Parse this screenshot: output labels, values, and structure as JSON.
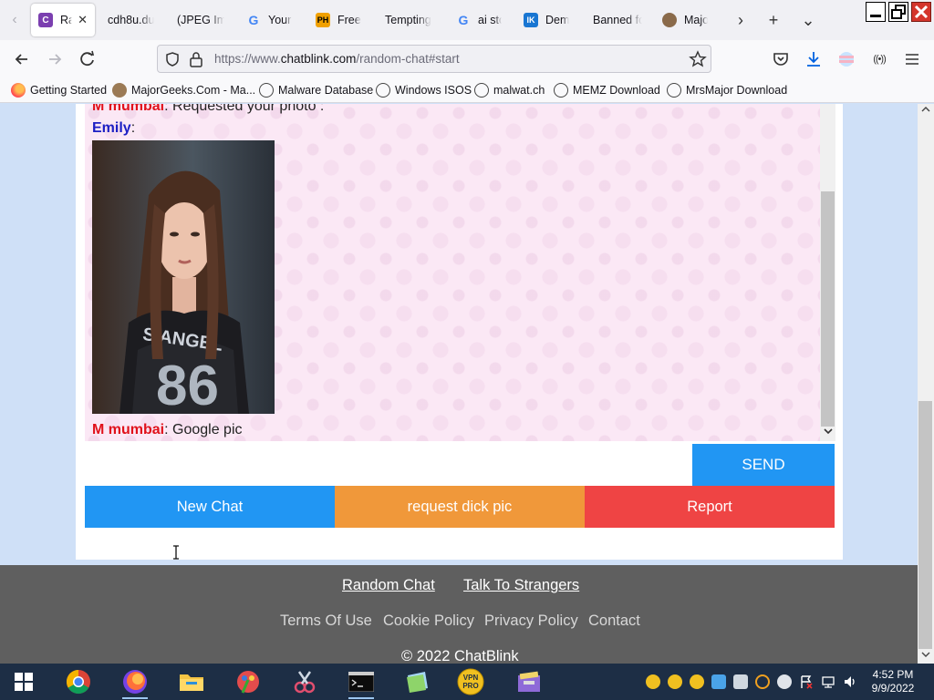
{
  "browser": {
    "tabs": [
      {
        "label": "Ran",
        "favicon": "C",
        "color": "#7b3fb0",
        "active": true
      },
      {
        "label": "cdh8u.du",
        "favicon": "",
        "color": "",
        "active": false
      },
      {
        "label": "(JPEG Ima",
        "favicon": "",
        "color": "",
        "active": false
      },
      {
        "label": "Your S",
        "favicon": "G",
        "color": "",
        "active": false
      },
      {
        "label": "Free P",
        "favicon": "PH",
        "color": "#f0a000",
        "active": false
      },
      {
        "label": "Tempting",
        "favicon": "",
        "color": "",
        "active": false
      },
      {
        "label": "ai stor",
        "favicon": "G",
        "color": "",
        "active": false
      },
      {
        "label": "Demo",
        "favicon": "IK",
        "color": "#1976d2",
        "active": false
      },
      {
        "label": "Banned fo",
        "favicon": "",
        "color": "",
        "active": false
      },
      {
        "label": "Major",
        "favicon": "",
        "color": "#8a6a4a",
        "active": false
      }
    ],
    "tab_close_glyph": "✕",
    "new_tab_glyph": "+",
    "list_tabs_glyph": "⌄",
    "url_prefix": "https://www.",
    "url_host": "chatblink.com",
    "url_path": "/random-chat#start",
    "bookmarks": [
      {
        "label": "Getting Started",
        "icon": "firefox-icon"
      },
      {
        "label": "MajorGeeks.Com - Ma...",
        "icon": "majorgeeks-icon"
      },
      {
        "label": "Malware Database",
        "icon": "globe-icon"
      },
      {
        "label": "Windows ISOS",
        "icon": "globe-icon"
      },
      {
        "label": "malwat.ch",
        "icon": "globe-icon"
      },
      {
        "label": "MEMZ Download",
        "icon": "globe-icon"
      },
      {
        "label": "MrsMajor Download",
        "icon": "globe-icon"
      }
    ]
  },
  "chat": {
    "messages": [
      {
        "sender": "M mumbai",
        "role": "stranger",
        "text": ": Requested your photo :"
      },
      {
        "sender": "Emily",
        "role": "you",
        "text": ":"
      },
      {
        "sender": "M mumbai",
        "role": "stranger",
        "text": ": Google pic"
      }
    ],
    "input_value": "",
    "send_label": "SEND",
    "actions": {
      "new_chat": "New Chat",
      "request": "request dick pic",
      "report": "Report"
    }
  },
  "footer": {
    "links_primary": [
      "Random Chat",
      "Talk To Strangers"
    ],
    "links_secondary": [
      "Terms Of Use",
      "Cookie Policy",
      "Privacy Policy",
      "Contact"
    ],
    "copyright": "© 2022 ChatBlink"
  },
  "taskbar": {
    "time": "4:52 PM",
    "date": "9/9/2022",
    "apps": [
      "windows-start-icon",
      "chrome-icon",
      "firefox-icon",
      "file-explorer-icon",
      "paint-icon",
      "scissors-icon",
      "cmd-icon",
      "notes-icon",
      "vpn-pro-icon",
      "archive-icon"
    ]
  },
  "colors": {
    "stranger": "#e0121b",
    "you": "#1c1fc4",
    "send": "#2196f3",
    "new_chat": "#2196f3",
    "request": "#f0983a",
    "report": "#ef4444",
    "page_bg": "#cfe0f7",
    "chat_bg": "#fbe8f5",
    "footer_bg": "#5f5f5f"
  }
}
